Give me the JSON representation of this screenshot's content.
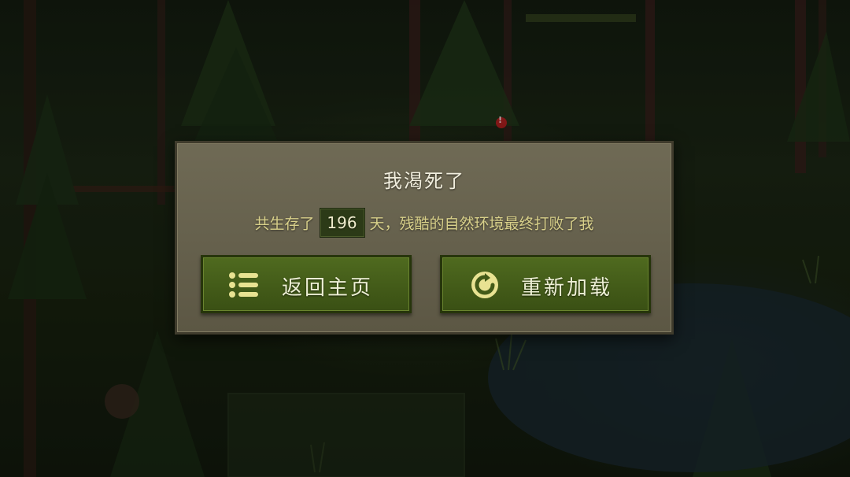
{
  "dialog": {
    "title": "我渴死了",
    "message_prefix": "共生存了",
    "days_survived": "196",
    "message_suffix": "天，残酷的自然环境最终打败了我"
  },
  "buttons": {
    "home_label": "返回主页",
    "home_icon": "menu-list-icon",
    "reload_label": "重新加载",
    "reload_icon": "reload-icon"
  },
  "hud": {
    "alert_marker": "!"
  },
  "colors": {
    "dialog_bg": "#6a6551",
    "button_green": "#4a631c",
    "accent_yellow": "#d8d08a"
  }
}
